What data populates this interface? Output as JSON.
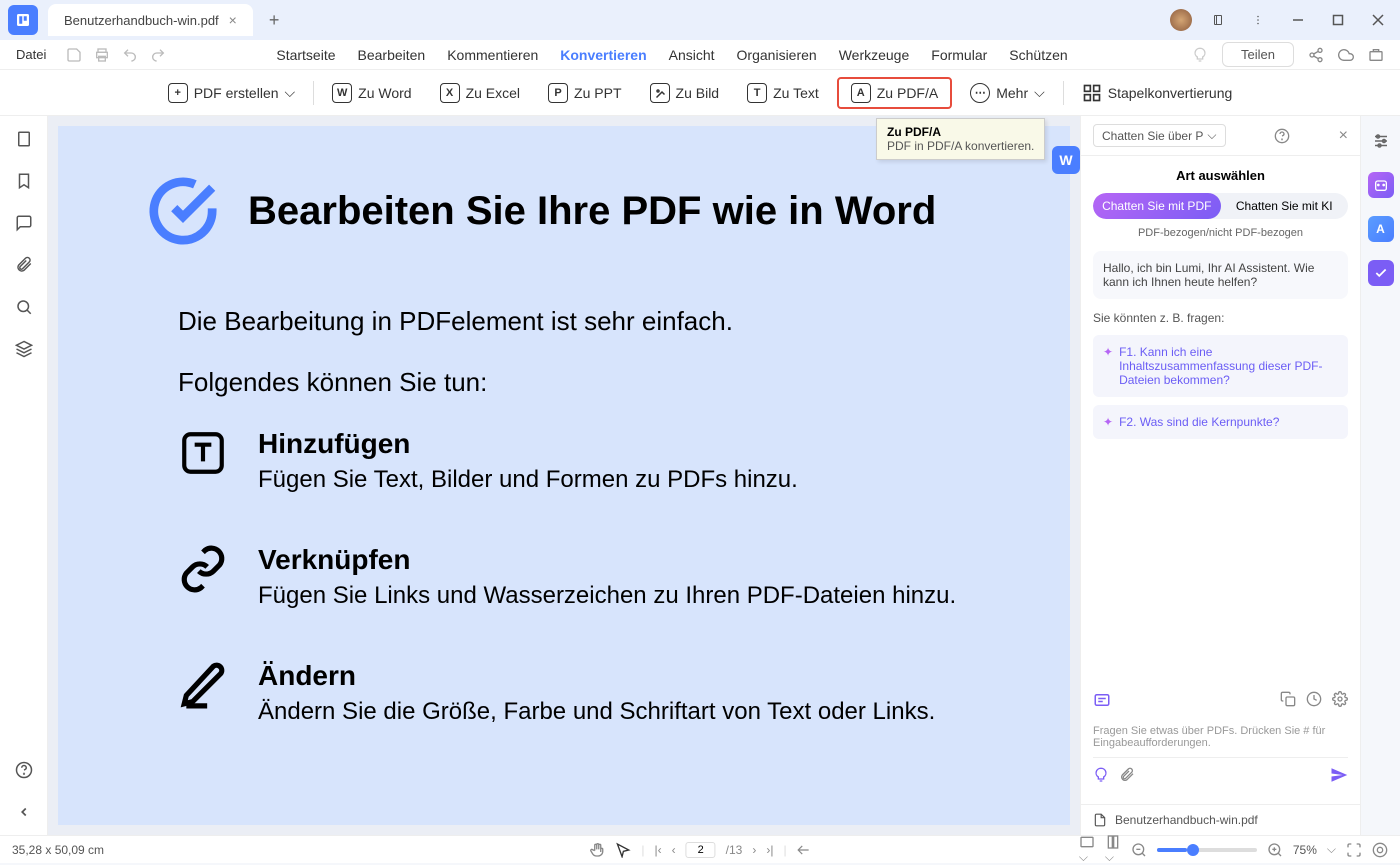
{
  "titlebar": {
    "tab_name": "Benutzerhandbuch-win.pdf"
  },
  "menubar": {
    "file": "Datei",
    "items": [
      "Startseite",
      "Bearbeiten",
      "Kommentieren",
      "Konvertieren",
      "Ansicht",
      "Organisieren",
      "Werkzeuge",
      "Formular",
      "Schützen"
    ],
    "active_index": 3,
    "teilen": "Teilen"
  },
  "toolbar": {
    "pdf_erstellen": "PDF erstellen",
    "zu_word": "Zu Word",
    "zu_excel": "Zu Excel",
    "zu_ppt": "Zu PPT",
    "zu_bild": "Zu Bild",
    "zu_text": "Zu Text",
    "zu_pdfa": "Zu PDF/A",
    "mehr": "Mehr",
    "stapel": "Stapelkonvertierung"
  },
  "tooltip": {
    "title": "Zu PDF/A",
    "desc": "PDF in PDF/A konvertieren."
  },
  "document": {
    "heading": "Bearbeiten Sie Ihre PDF wie in Word",
    "intro1": "Die Bearbeitung in PDFelement ist sehr einfach.",
    "intro2": "Folgendes können Sie tun:",
    "sections": [
      {
        "title": "Hinzufügen",
        "desc": "Fügen Sie Text, Bilder und Formen zu PDFs hinzu."
      },
      {
        "title": "Verknüpfen",
        "desc": "Fügen Sie Links und Wasserzeichen zu Ihren PDF-Dateien hinzu."
      },
      {
        "title": "Ändern",
        "desc": "Ändern Sie die Größe, Farbe und Schriftart von Text oder Links."
      }
    ]
  },
  "rightpanel": {
    "dropdown": "Chatten Sie über P",
    "title": "Art auswählen",
    "tab_pdf": "Chatten Sie mit PDF",
    "tab_ki": "Chatten Sie mit KI",
    "subtitle": "PDF-bezogen/nicht PDF-bezogen",
    "greeting": "Hallo, ich bin Lumi, Ihr AI Assistent. Wie kann ich Ihnen heute helfen?",
    "suggest_title": "Sie könnten z. B. fragen:",
    "suggest1": "F1. Kann ich eine Inhaltszusammenfassung dieser PDF-Dateien bekommen?",
    "suggest2": "F2. Was sind die Kernpunkte?",
    "hint": "Fragen Sie etwas über PDFs. Drücken Sie # für Eingabeaufforderungen.",
    "filename": "Benutzerhandbuch-win.pdf"
  },
  "statusbar": {
    "dimensions": "35,28 x 50,09 cm",
    "current_page": "2",
    "total_pages": "/13",
    "zoom": "75%"
  }
}
